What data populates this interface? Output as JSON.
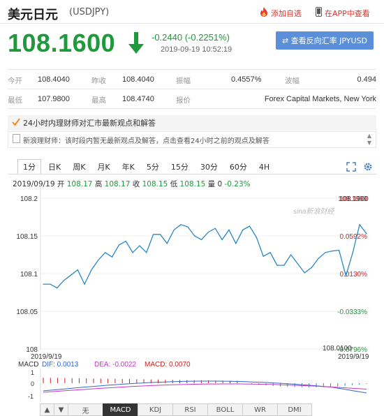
{
  "header": {
    "title": "美元日元",
    "symbol": "(USDJPY)",
    "add_favorite": "添加自选",
    "view_in_app": "在APP中查看"
  },
  "quote": {
    "price": "108.1600",
    "change": "-0.2440 (-0.2251%)",
    "timestamp": "2019-09-19 10:52:19",
    "reverse_button": "⇄ 查看反向汇率 JPYUSD",
    "direction": "down",
    "down_color": "#1f9a3a"
  },
  "stats": {
    "open_label": "今开",
    "open": "108.4040",
    "prev_close_label": "昨收",
    "prev_close": "108.4040",
    "amplitude_label": "振幅",
    "amplitude": "0.4557%",
    "volatility_label": "波幅",
    "volatility": "0.494",
    "low_label": "最低",
    "low": "107.9800",
    "high_label": "最高",
    "high": "108.4740",
    "quote_source_label": "报价",
    "quote_source": "Forex Capital Markets, New York"
  },
  "news": {
    "heading": "24小时内理财师对汇市最新观点和解答",
    "body": "新浪理财师：该时段内暂无最新观点及解答，点击查看24小时之前的观点及解答"
  },
  "tabs": [
    "1分",
    "日K",
    "周K",
    "月K",
    "年K",
    "5分",
    "15分",
    "30分",
    "60分",
    "4H"
  ],
  "active_tab": "1分",
  "ohlc": {
    "date": "2019/09/19",
    "open_label": "开",
    "open": "108.17",
    "high_label": "高",
    "high": "108.17",
    "close_label": "收",
    "close": "108.15",
    "low_label": "低",
    "low": "108.15",
    "volume_label": "量",
    "volume": "0",
    "change_pct": "-0.23%"
  },
  "chart_data": {
    "type": "line",
    "watermark": "sina新浪财经",
    "y_left_ticks": [
      "108.2",
      "108.15",
      "108.1",
      "108.05",
      "108"
    ],
    "y_right_labels": [
      "108.1999",
      "0.0592%",
      "0.0130%",
      "-0.0333%",
      "-0.0796%"
    ],
    "y_right_top_overlay": "108.1900",
    "y_right_bottom_overlay": "108.0100",
    "x_start_label": "2019/9/19",
    "x_end_label": "2019/9/19",
    "ylim": [
      108.0,
      108.2
    ],
    "values": [
      108.086,
      108.086,
      108.081,
      108.091,
      108.098,
      108.105,
      108.086,
      108.105,
      108.118,
      108.128,
      108.122,
      108.138,
      108.143,
      108.128,
      108.137,
      108.128,
      108.152,
      108.152,
      108.14,
      108.158,
      108.165,
      108.162,
      108.15,
      108.145,
      108.155,
      108.16,
      108.145,
      108.158,
      108.14,
      108.158,
      108.163,
      108.148,
      108.123,
      108.128,
      108.111,
      108.111,
      108.125,
      108.113,
      108.101,
      108.108,
      108.12,
      108.128,
      108.13,
      108.131,
      108.097,
      108.128,
      108.165,
      108.153
    ]
  },
  "macd": {
    "label": "MACD",
    "dif_label": "DIF: 0.0013",
    "dea_label": "DEA: -0.0022",
    "macd_label": "MACD: 0.0070",
    "y_ticks": [
      "1",
      "0",
      "-1"
    ],
    "bar_color_pos": "#cc2222",
    "bar_color_neg": "#1a9a9a",
    "dif_color": "#3366cc",
    "dea_color": "#cc33cc"
  },
  "tools": {
    "up": "▲",
    "down": "▼",
    "items": [
      "无",
      "MACD",
      "KDJ",
      "RSI",
      "BOLL",
      "WR",
      "DMI"
    ],
    "active": "MACD"
  }
}
